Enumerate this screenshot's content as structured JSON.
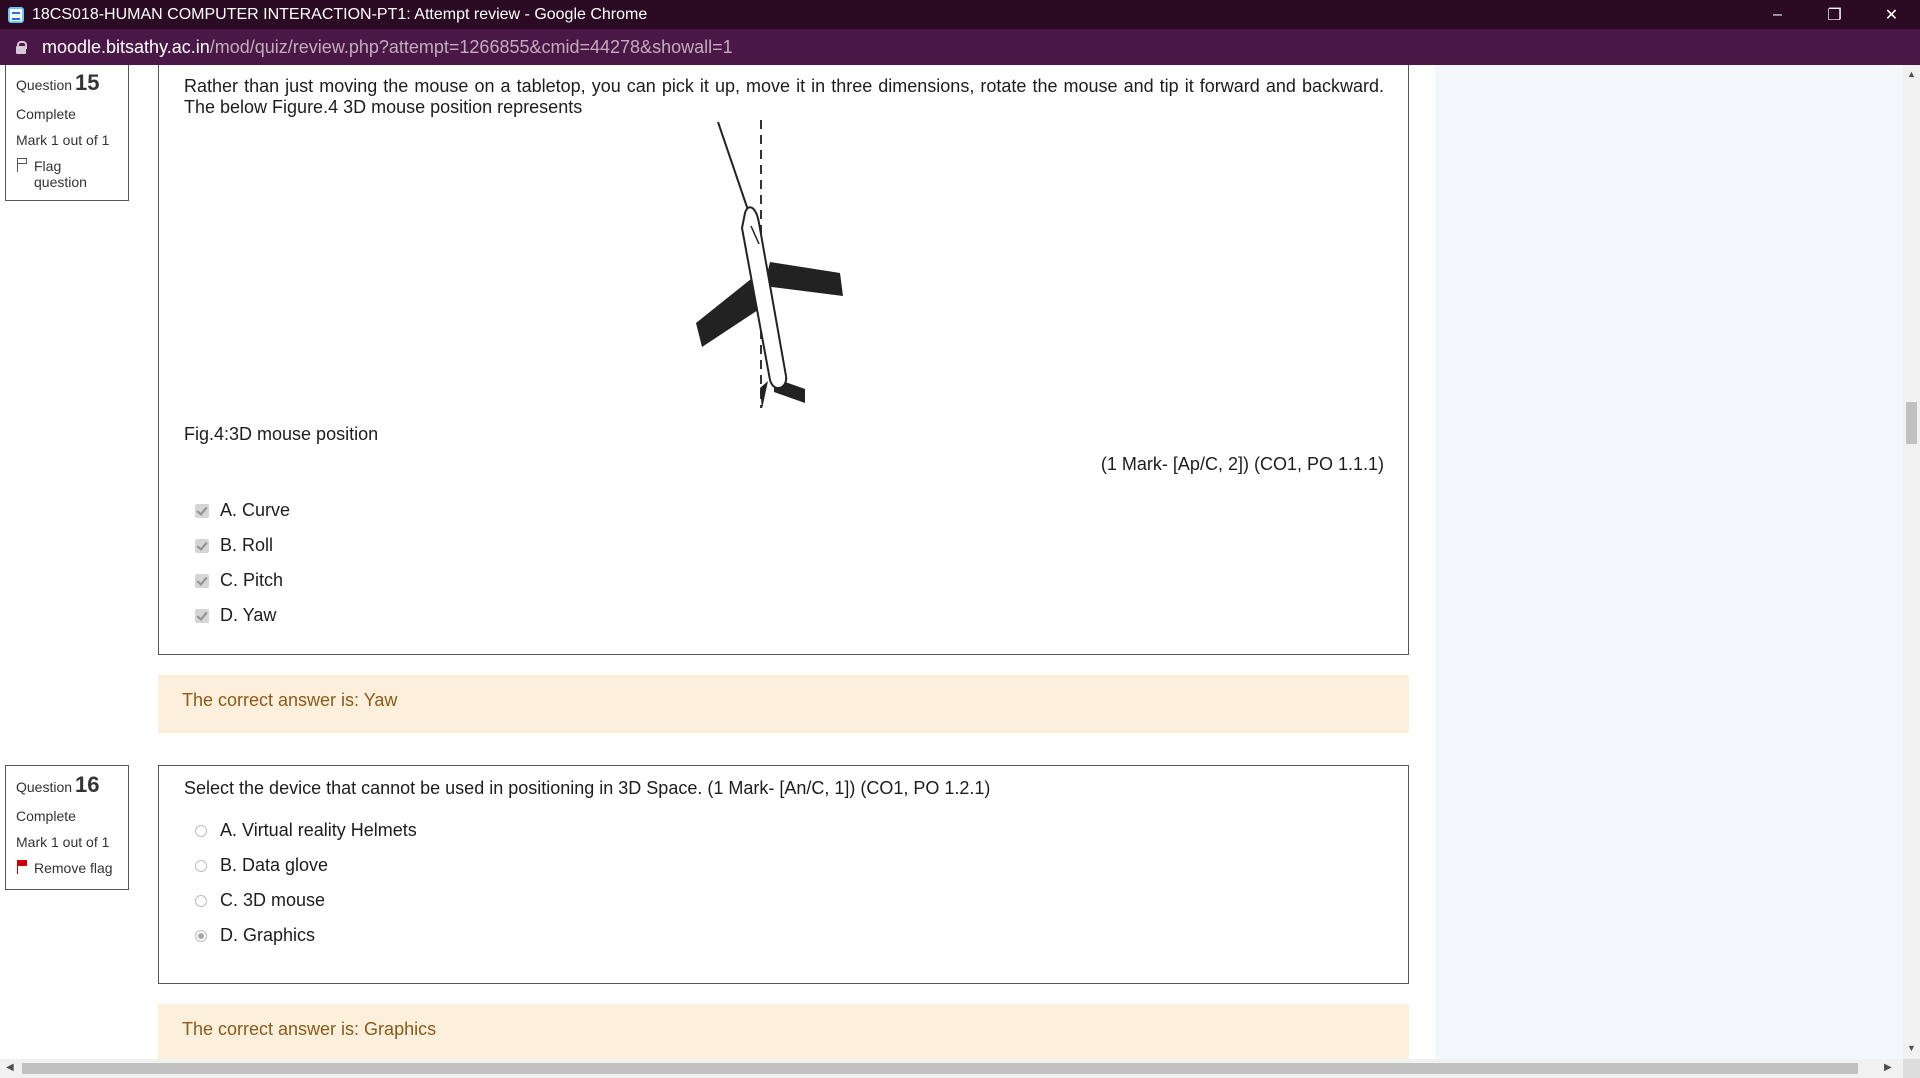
{
  "window": {
    "title": "18CS018-HUMAN COMPUTER INTERACTION-PT1: Attempt review - Google Chrome",
    "minimize": "–",
    "restore": "❐",
    "close": "✕"
  },
  "address": {
    "host": "moodle.bitsathy.ac.in",
    "path": "/mod/quiz/review.php?attempt=1266855&cmid=44278&showall=1"
  },
  "questions": [
    {
      "label": "Question",
      "number": "15",
      "state": "Complete",
      "mark": "Mark 1 out of 1",
      "flag_label": "Flag question",
      "text": "Rather than just moving the mouse on a tabletop, you can pick it up, move it in three dimensions, rotate the mouse and tip it forward and backward. The below Figure.4 3D mouse position represents",
      "caption": "Fig.4:3D mouse position",
      "marks": "(1 Mark- [Ap/C, 2]) (CO1, PO 1.1.1)",
      "options": [
        "A. Curve",
        "B. Roll",
        "C. Pitch",
        "D. Yaw"
      ],
      "feedback": "The correct answer is: Yaw"
    },
    {
      "label": "Question",
      "number": "16",
      "state": "Complete",
      "mark": "Mark 1 out of 1",
      "flag_label": "Remove flag",
      "text": "Select the device that cannot be used in positioning in 3D Space. (1 Mark- [An/C, 1]) (CO1, PO 1.2.1)",
      "options": [
        "A. Virtual reality Helmets",
        "B. Data glove",
        "C. 3D mouse",
        "D. Graphics"
      ],
      "selected_option": "D. Graphics",
      "feedback": "The correct answer is: Graphics"
    }
  ],
  "scrollbar": {
    "up": "▲",
    "down": "▼",
    "left": "◀",
    "right": "▶",
    "vertical_position": 0.36
  },
  "colors": {
    "titlebar": "#2b0a24",
    "addressbar": "#4a1846",
    "feedback_bg": "#fcefdc",
    "feedback_text": "#8b5a19"
  }
}
